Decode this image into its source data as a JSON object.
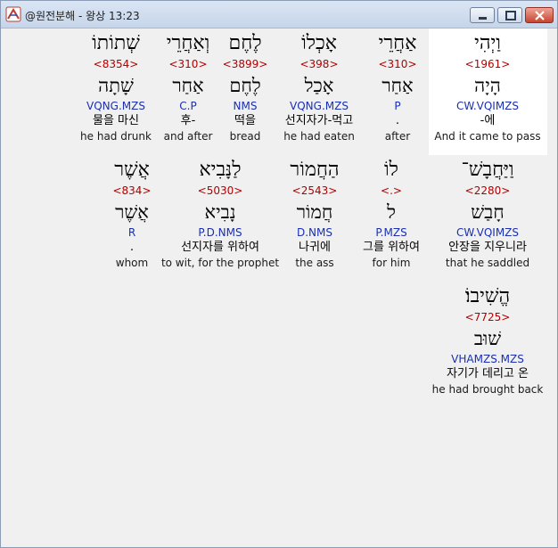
{
  "window": {
    "title": "@원전분해 - 왕상 13:23",
    "colors": {
      "strong": "#b20000",
      "morph": "#1a2fb0",
      "highlight": "#ffffff"
    }
  },
  "words": [
    {
      "heb": "וַיְהִי",
      "strong": "<1961>",
      "lemma": "הָיָה",
      "morph": "CW.VQIMZS",
      "kor": "-에",
      "eng": "And it came to pass",
      "highlighted": true
    },
    {
      "heb": "אַחֲרֵי",
      "strong": "<310>",
      "lemma": "אַחַר",
      "morph": "P",
      "kor": ".",
      "eng": "after"
    },
    {
      "heb": "אָכְלוֹ",
      "strong": "<398>",
      "lemma": "אָכַל",
      "morph": "VQNG.MZS",
      "kor": "선지자가-먹고",
      "eng": "he had eaten"
    },
    {
      "heb": "לֶחֶם",
      "strong": "<3899>",
      "lemma": "לֶחֶם",
      "morph": "NMS",
      "kor": "떡을",
      "eng": "bread"
    },
    {
      "heb": "וְאַחֲרֵי",
      "strong": "<310>",
      "lemma": "אַחַר",
      "morph": "C.P",
      "kor": "후-",
      "eng": "and after"
    },
    {
      "heb": "שְׁתוֹתוֹ",
      "strong": "<8354>",
      "lemma": "שָׁתָה",
      "morph": "VQNG.MZS",
      "kor": "물을 마신",
      "eng": "he had drunk"
    },
    {
      "heb": "וַיַּחֲבָשׁ־",
      "strong": "<2280>",
      "lemma": "חָבַשׁ",
      "morph": "CW.VQIMZS",
      "kor": "안장을 지우니라",
      "eng": "that he saddled"
    },
    {
      "heb": "לוֹ",
      "strong": "<.>",
      "lemma": "ל",
      "morph": "P.MZS",
      "kor": "그를 위하여",
      "eng": "for him"
    },
    {
      "heb": "הַחֲמוֹר",
      "strong": "<2543>",
      "lemma": "חֲמוֹר",
      "morph": "D.NMS",
      "kor": "나귀에",
      "eng": "the ass"
    },
    {
      "heb": "לַנָּבִיא",
      "strong": "<5030>",
      "lemma": "נָבִיא",
      "morph": "P.D.NMS",
      "kor": "선지자를 위하여",
      "eng": "to wit, for the prophet"
    },
    {
      "heb": "אֲשֶׁר",
      "strong": "<834>",
      "lemma": "אֲשֶׁר",
      "morph": "R",
      "kor": ".",
      "eng": "whom"
    },
    {
      "heb": "הֱשִׁיבוֹ׃",
      "strong": "<7725>",
      "lemma": "שׁוּב",
      "morph": "VHAMZS.MZS",
      "kor": "자기가 데리고 온",
      "eng": "he had brought back"
    }
  ]
}
